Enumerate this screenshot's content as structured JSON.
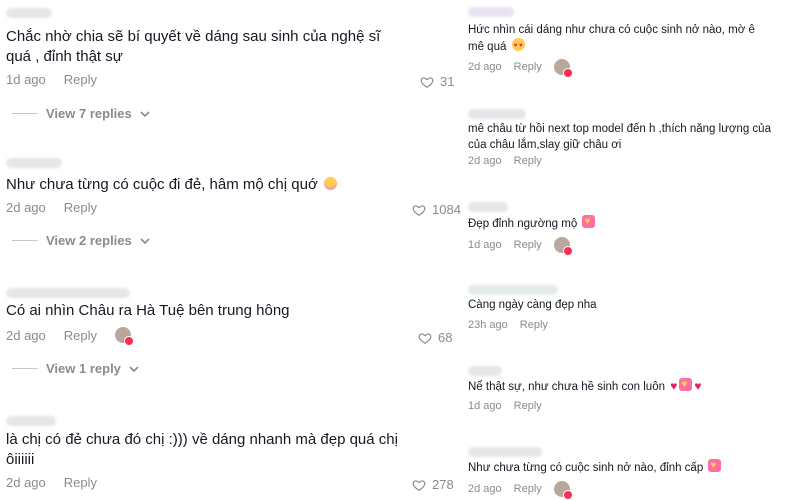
{
  "left": [
    {
      "text": "Chắc nhờ chia sẽ bí quyết về dáng sau sinh của nghệ sĩ quá , đỉnh thật sự",
      "time": "1d ago",
      "reply": "Reply",
      "likes": "31",
      "view_replies": "View 7 replies"
    },
    {
      "text": "Như chưa từng có cuộc đi đẻ, hâm mộ chị quớ",
      "emoji": "blush-face",
      "time": "2d ago",
      "reply": "Reply",
      "likes": "1084",
      "view_replies": "View 2 replies"
    },
    {
      "text": "Có ai nhìn Châu ra Hà Tuệ bên trung hông",
      "time": "2d ago",
      "reply": "Reply",
      "likes": "68",
      "view_replies": "View 1 reply"
    },
    {
      "text": "là chị có đẻ chưa đó chị :))) về dáng nhanh mà đẹp quá chị ôiiiiii",
      "time": "2d ago",
      "reply": "Reply",
      "likes": "278"
    }
  ],
  "right": [
    {
      "text": "Hức nhìn cái dáng như chưa có cuộc sinh nở nào, mờ ê mê quá",
      "emoji": "heart-eyes",
      "time": "2d ago",
      "reply": "Reply"
    },
    {
      "text": "mê châu từ hồi next top model đến h ,thích năng lượng của của châu lắm,slay giữ châu ơi",
      "time": "2d ago",
      "reply": "Reply"
    },
    {
      "text": "Đẹp đỉnh ngường mộ",
      "emoji": "sparkling-hearts",
      "time": "1d ago",
      "reply": "Reply"
    },
    {
      "text": "Càng ngày càng đẹp nha",
      "time": "23h ago",
      "reply": "Reply"
    },
    {
      "text": "Nể thật sự, như chưa hề sinh con luôn",
      "emoji": "hearts",
      "time": "1d ago",
      "reply": "Reply"
    },
    {
      "text": "Như chưa từng có cuộc sinh nở nào, đỉnh cấp",
      "emoji": "sparkling-hearts",
      "time": "2d ago",
      "reply": "Reply"
    }
  ]
}
